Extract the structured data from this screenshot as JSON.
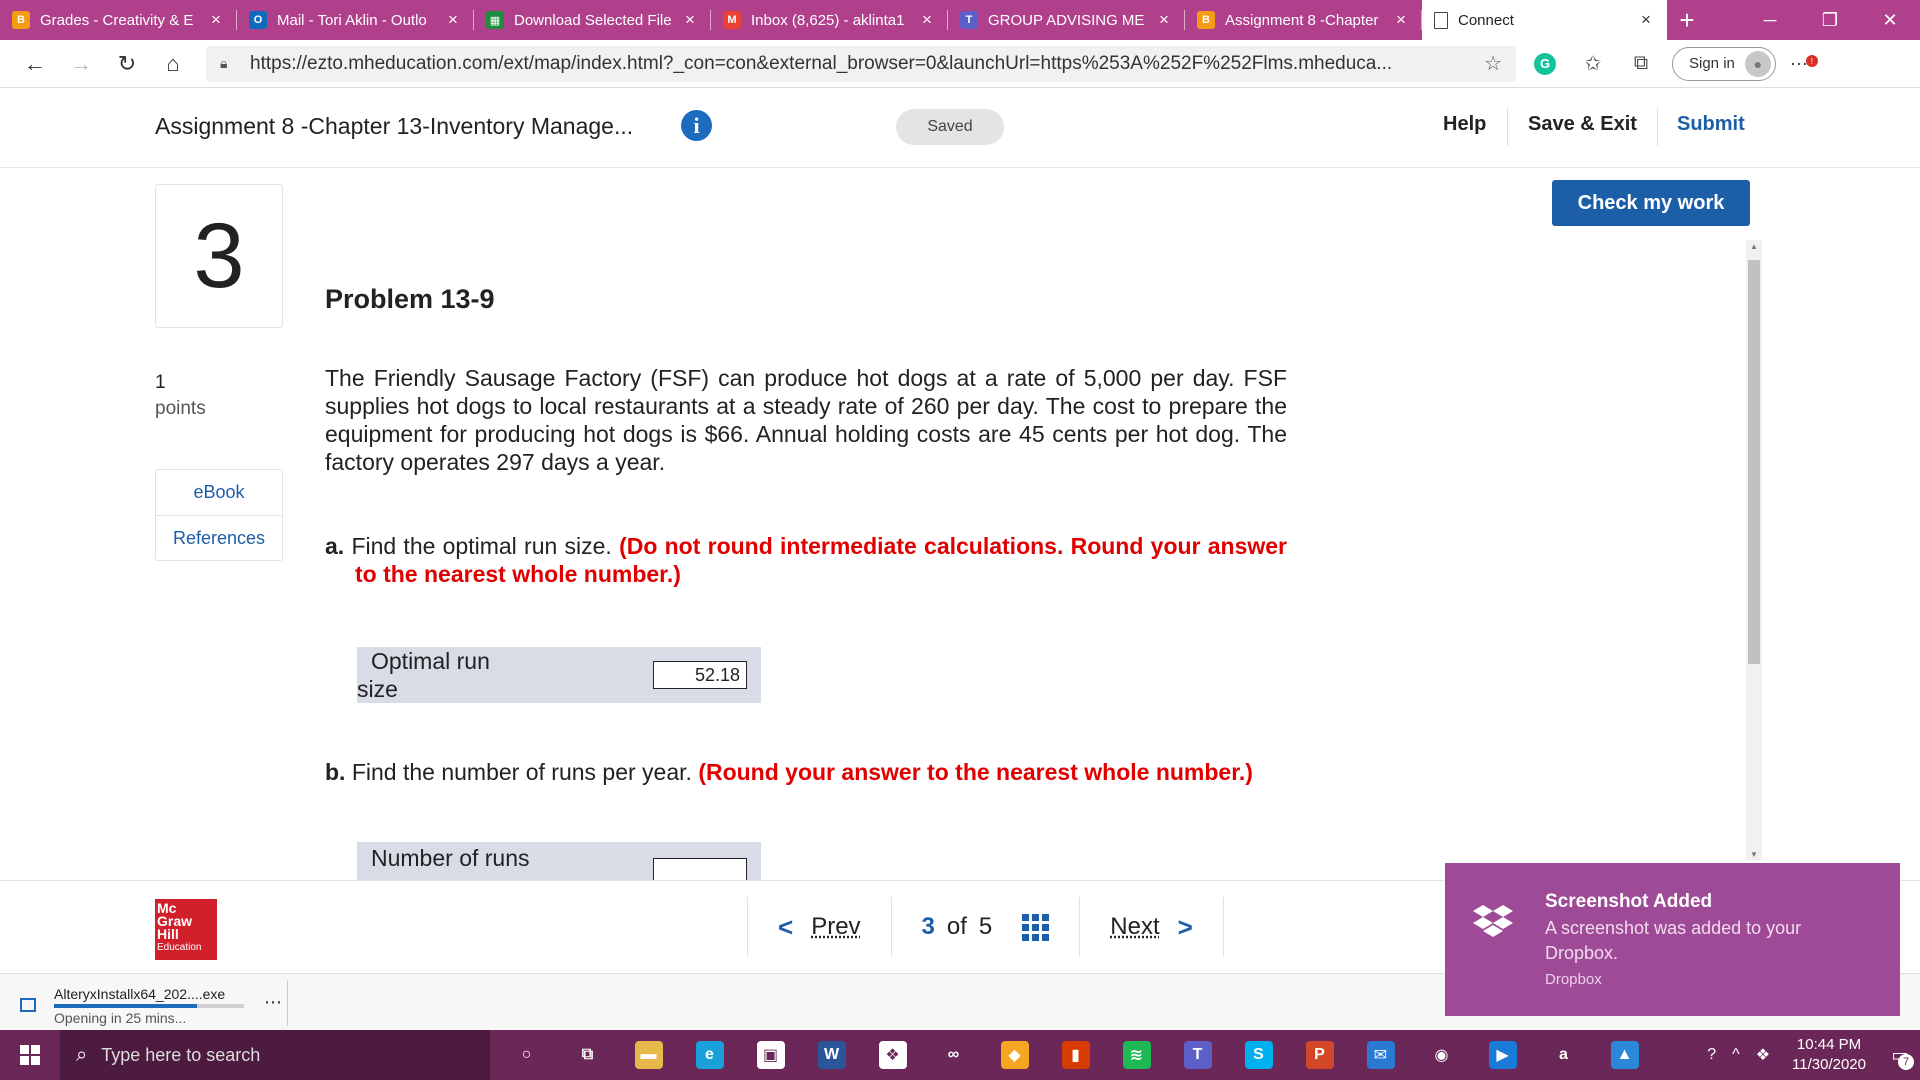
{
  "browser": {
    "tabs": [
      {
        "title": "Grades - Creativity & E",
        "icon": "b-icon",
        "color": "#f39c12",
        "glyph": "B"
      },
      {
        "title": "Mail - Tori Aklin - Outlo",
        "icon": "outlook-icon",
        "color": "#0f6cbd",
        "glyph": "O"
      },
      {
        "title": "Download Selected File",
        "icon": "sheets-icon",
        "color": "#1e8e3e",
        "glyph": "▦"
      },
      {
        "title": "Inbox (8,625) - aklinta1",
        "icon": "gmail-icon",
        "color": "#ea4335",
        "glyph": "M"
      },
      {
        "title": "GROUP ADVISING ME",
        "icon": "teams-icon",
        "color": "#5b5fc7",
        "glyph": "T"
      },
      {
        "title": "Assignment 8 -Chapter",
        "icon": "b-icon",
        "color": "#f39c12",
        "glyph": "B"
      }
    ],
    "active_tab": {
      "title": "Connect"
    },
    "url": "https://ezto.mheducation.com/ext/map/index.html?_con=con&external_browser=0&launchUrl=https%253A%252F%252Flms.mheduca...",
    "sign_in_label": "Sign in"
  },
  "header": {
    "assignment_title": "Assignment 8 -Chapter 13-Inventory Manage...",
    "saved_label": "Saved",
    "help_label": "Help",
    "save_exit_label": "Save & Exit",
    "submit_label": "Submit"
  },
  "question": {
    "number": "3",
    "points_value": "1",
    "points_label": "points",
    "ebook_label": "eBook",
    "references_label": "References",
    "check_label": "Check my work",
    "title": "Problem 13-9",
    "text": "The Friendly Sausage Factory (FSF) can produce hot dogs at a rate of 5,000 per day. FSF supplies hot dogs to local restaurants at a steady rate of 260 per day. The cost to prepare the equipment for producing hot dogs is $66. Annual holding costs are 45 cents per hot dog. The factory operates 297 days a year.",
    "part_a": {
      "lead": "a.",
      "text": "Find the optimal run size.",
      "instruction": "(Do not round intermediate calculations. Round your answer to the nearest whole number.)",
      "label": "Optimal run size",
      "value": "52.18"
    },
    "part_b": {
      "lead": "b.",
      "text": "Find the number of runs per year.",
      "instruction": "(Round your answer to the nearest whole number.)",
      "label": "Number of runs",
      "value": ""
    }
  },
  "footer": {
    "logo_lines": [
      "Mc",
      "Graw",
      "Hill",
      "Education"
    ],
    "prev_label": "Prev",
    "current_page": "3",
    "of_label": "of",
    "total_pages": "5",
    "next_label": "Next"
  },
  "downloads": {
    "file_name": "AlteryxInstallx64_202....exe",
    "status": "Opening in 25 mins...",
    "progress": 0.75
  },
  "toast": {
    "title": "Screenshot Added",
    "body": "A screenshot was added to your Dropbox.",
    "source": "Dropbox"
  },
  "taskbar": {
    "search_placeholder": "Type here to search",
    "apps": [
      {
        "name": "cortana-icon",
        "color": "transparent",
        "glyph": "○"
      },
      {
        "name": "task-view-icon",
        "color": "transparent",
        "glyph": "⧉"
      },
      {
        "name": "file-explorer-icon",
        "color": "#e8b84a",
        "glyph": "▬"
      },
      {
        "name": "edge-icon",
        "color": "#1aa0d8",
        "glyph": "e"
      },
      {
        "name": "store-icon",
        "color": "#ffffff",
        "glyph": "▣"
      },
      {
        "name": "word-icon",
        "color": "#2b579a",
        "glyph": "W"
      },
      {
        "name": "dropbox-icon",
        "color": "#ffffff",
        "glyph": "❖"
      },
      {
        "name": "infinity-icon",
        "color": "transparent",
        "glyph": "∞"
      },
      {
        "name": "brave-icon",
        "color": "#f6a623",
        "glyph": "◆"
      },
      {
        "name": "office-icon",
        "color": "#d83b01",
        "glyph": "▮"
      },
      {
        "name": "spotify-icon",
        "color": "#1db954",
        "glyph": "≋"
      },
      {
        "name": "teams-icon",
        "color": "#5b5fc7",
        "glyph": "T"
      },
      {
        "name": "skype-icon",
        "color": "#00aff0",
        "glyph": "S"
      },
      {
        "name": "powerpoint-icon",
        "color": "#d24726",
        "glyph": "P"
      },
      {
        "name": "mail-icon",
        "color": "#2a7ad1",
        "glyph": "✉"
      },
      {
        "name": "media-icon",
        "color": "transparent",
        "glyph": "◉"
      },
      {
        "name": "video-icon",
        "color": "#1a7ad8",
        "glyph": "▶"
      },
      {
        "name": "amazon-icon",
        "color": "transparent",
        "glyph": "a"
      },
      {
        "name": "photos-icon",
        "color": "#2b88d8",
        "glyph": "▲"
      }
    ],
    "time": "10:44 PM",
    "date": "11/30/2020",
    "notification_count": "7"
  }
}
